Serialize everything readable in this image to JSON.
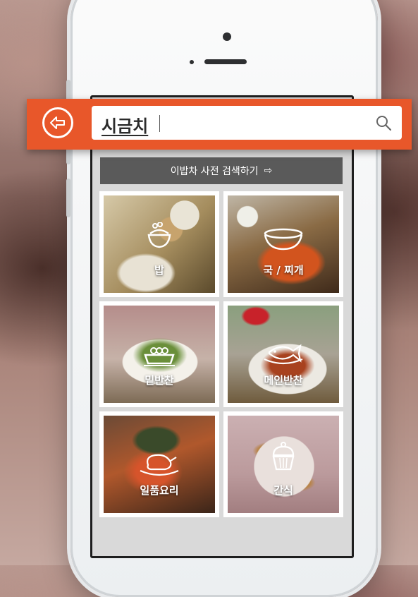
{
  "search": {
    "query": "시금치"
  },
  "dictionary_link": {
    "label": "이밥차 사전 검색하기",
    "arrow": "⇨"
  },
  "categories": [
    {
      "label": "밥",
      "icon": "rice-bowl-icon"
    },
    {
      "label": "국 / 찌개",
      "icon": "soup-bowl-icon"
    },
    {
      "label": "밑반찬",
      "icon": "side-dish-icon"
    },
    {
      "label": "메인반찬",
      "icon": "fish-dish-icon"
    },
    {
      "label": "일품요리",
      "icon": "chicken-dish-icon"
    },
    {
      "label": "간식",
      "icon": "cupcake-icon"
    }
  ],
  "colors": {
    "accent": "#e8572a",
    "dict_bar": "#5a5a5a"
  }
}
